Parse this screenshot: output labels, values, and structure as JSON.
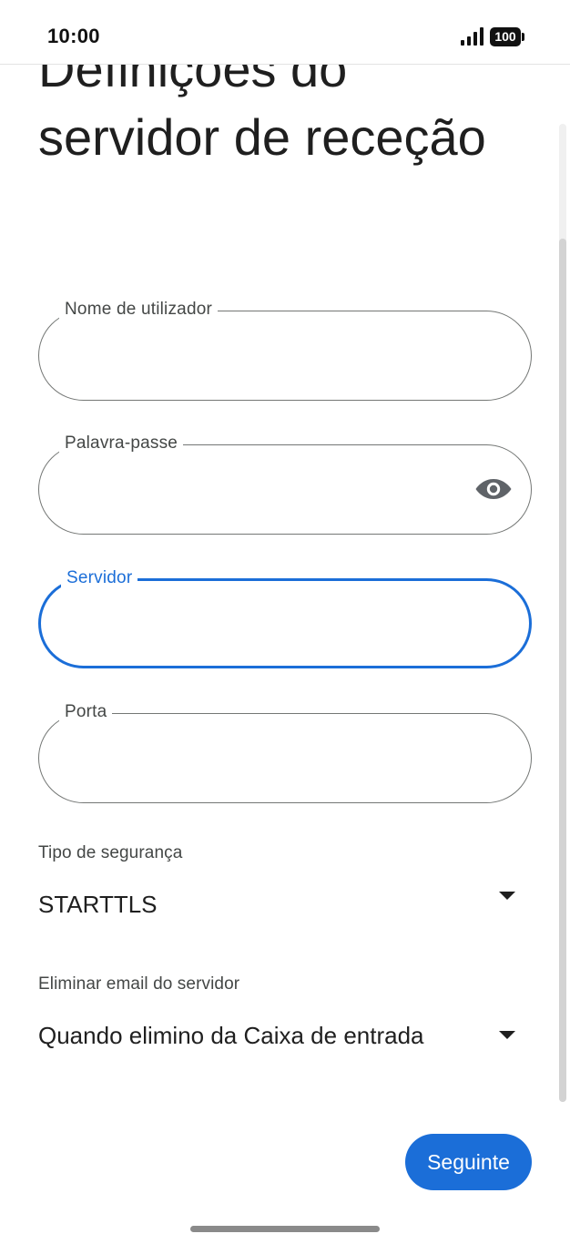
{
  "status_bar": {
    "time": "10:00",
    "battery": "100",
    "signal_icon": "cellular-signal-icon",
    "battery_icon": "battery-icon"
  },
  "page": {
    "title": "Definições do servidor de receção"
  },
  "fields": {
    "username": {
      "label": "Nome de utilizador",
      "value": ""
    },
    "password": {
      "label": "Palavra-passe",
      "value": "",
      "toggle_icon": "eye-icon"
    },
    "server": {
      "label": "Servidor",
      "value": ""
    },
    "port": {
      "label": "Porta",
      "value": ""
    }
  },
  "security": {
    "label": "Tipo de segurança",
    "selected": "STARTTLS",
    "arrow_icon": "dropdown-arrow-icon"
  },
  "delete_email": {
    "label": "Eliminar email do servidor",
    "selected": "Quando elimino da Caixa de entrada",
    "arrow_icon": "dropdown-arrow-icon"
  },
  "actions": {
    "next_label": "Seguinte"
  },
  "colors": {
    "accent": "#1b6ed8",
    "outline": "#747775",
    "text": "#1f1f1f",
    "label_text": "#444746"
  }
}
